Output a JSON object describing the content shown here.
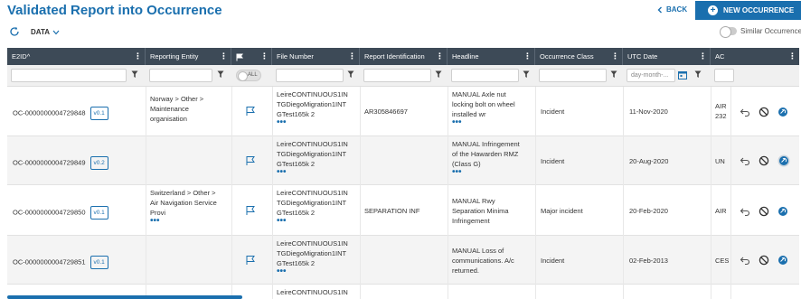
{
  "header": {
    "title": "Validated Report into Occurrence",
    "back_label": "BACK",
    "new_button_label": "NEW OCCURRENCE"
  },
  "toolbar": {
    "data_menu_label": "DATA",
    "similar_label": "Similar Occurrence"
  },
  "columns": [
    {
      "label": "E2ID"
    },
    {
      "label": "Reporting Entity"
    },
    {
      "label": ""
    },
    {
      "label": "File Number"
    },
    {
      "label": "Report Identification"
    },
    {
      "label": "Headline"
    },
    {
      "label": "Occurrence Class"
    },
    {
      "label": "UTC Date"
    },
    {
      "label": "AC"
    }
  ],
  "filters": {
    "flag_toggle_label": "ALL",
    "date_placeholder": "day-month-..."
  },
  "rows": [
    {
      "e2id": "OC-0000000004729848",
      "version": "v0.1",
      "reporting_entity": [
        "Norway > Other >",
        "Maintenance",
        "organisation"
      ],
      "file_number": [
        "LeireCONTINUOUS1IN",
        "TGDiegoMigration1INT",
        "GTest165k 2"
      ],
      "report_id": "AR305846697",
      "headline": [
        "MANUAL Axle nut",
        "locking bolt on wheel",
        "installed wr"
      ],
      "occ_class": "Incident",
      "utc_date": "11-Nov-2020",
      "ac": [
        "AIR",
        "232"
      ]
    },
    {
      "e2id": "OC-0000000004729849",
      "version": "v0.2",
      "reporting_entity": [],
      "file_number": [
        "LeireCONTINUOUS1IN",
        "TGDiegoMigration1INT",
        "GTest165k 2"
      ],
      "report_id": "",
      "headline": [
        "MANUAL Infringement",
        "of the Hawarden RMZ",
        "(Class G)"
      ],
      "occ_class": "Incident",
      "utc_date": "20-Aug-2020",
      "ac": [
        "UN"
      ]
    },
    {
      "e2id": "OC-0000000004729850",
      "version": "v0.1",
      "reporting_entity": [
        "Switzerland > Other >",
        "Air Navigation Service",
        "Provi"
      ],
      "file_number": [
        "LeireCONTINUOUS1IN",
        "TGDiegoMigration1INT",
        "GTest165k 2"
      ],
      "report_id": "SEPARATION INF",
      "headline": [
        "MANUAL Rwy",
        "Separation Minima",
        "Infringement"
      ],
      "occ_class": "Major incident",
      "utc_date": "20-Feb-2020",
      "ac": [
        "AIR"
      ]
    },
    {
      "e2id": "OC-0000000004729851",
      "version": "v0.1",
      "reporting_entity": [],
      "file_number": [
        "LeireCONTINUOUS1IN",
        "TGDiegoMigration1INT",
        "GTest165k 2"
      ],
      "report_id": "",
      "headline": [
        "MANUAL Loss of",
        "communications. A/c",
        "returned."
      ],
      "occ_class": "Incident",
      "utc_date": "02-Feb-2013",
      "ac": [
        "CES"
      ]
    },
    {
      "e2id": "",
      "version": "",
      "reporting_entity": [],
      "file_number": [
        "LeireCONTINUOUS1IN"
      ],
      "report_id": "",
      "headline": [],
      "occ_class": "",
      "utc_date": "",
      "ac": []
    }
  ],
  "icons": {
    "back": "chevron-left-icon",
    "new": "plus-circle-icon",
    "refresh": "refresh-icon",
    "flag": "flag-icon",
    "undo": "undo-icon",
    "block": "block-icon",
    "link": "link-icon",
    "filter": "funnel-icon",
    "calendar": "calendar-icon"
  },
  "colors": {
    "accent": "#1a6fae",
    "header_bg": "#3d4a57"
  }
}
